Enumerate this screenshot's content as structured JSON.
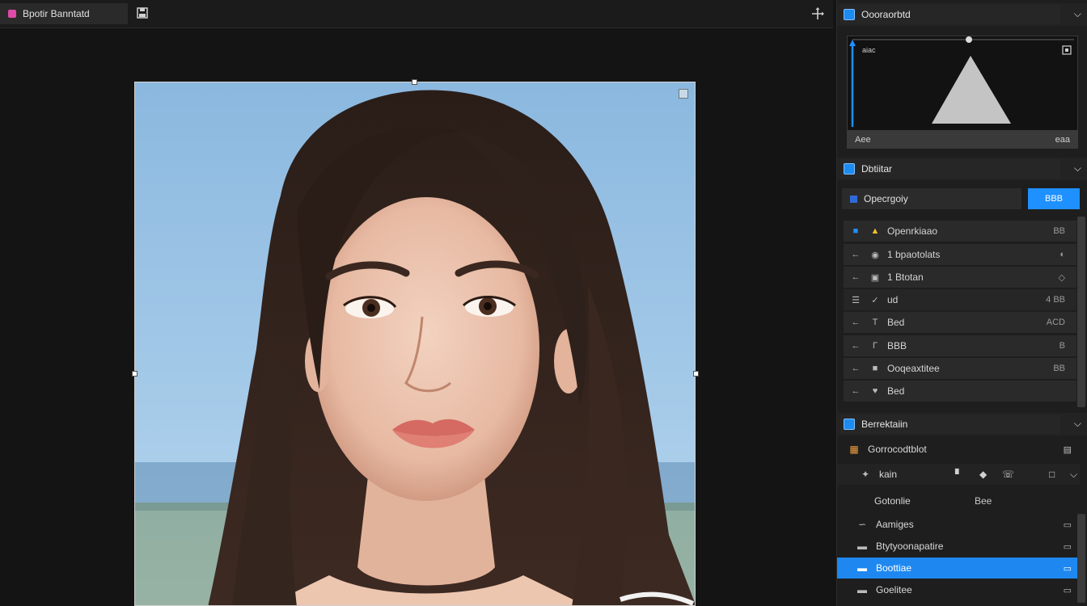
{
  "tab": {
    "title": "Bpotir Banntatd"
  },
  "histogram": {
    "title": "Oooraorbtd",
    "corner_label": "aiac",
    "foot_left": "Aee",
    "foot_right": "eaa"
  },
  "layers_panel": {
    "title": "Dbtiitar",
    "blend_mode": "Opecrgoiy",
    "blend_button": "BBB",
    "rows": [
      {
        "label": "Openrkiaao",
        "right": "BB"
      },
      {
        "label": "1   bpaotolats",
        "right": "◐"
      },
      {
        "label": "1   Btotan",
        "right": "◇"
      },
      {
        "label": "ud",
        "right": "4 BB"
      },
      {
        "label": "Bed",
        "right": "ACD"
      },
      {
        "label": "BBB",
        "right": "B"
      },
      {
        "label": "Ooqeaxtitee",
        "right": "BB"
      },
      {
        "label": "Bed",
        "right": ""
      }
    ]
  },
  "adjust_panel": {
    "title": "Berrektaiin",
    "subtitle": "Gorrocodtblot",
    "tool_label": "kain",
    "subheader_left": "Gotonlie",
    "subheader_right": "Bee",
    "rows": [
      {
        "label": "Aamiges",
        "right": "▭",
        "selected": false
      },
      {
        "label": "Btytyoonapatire",
        "right": "▭",
        "selected": false
      },
      {
        "label": "Boottiae",
        "right": "▭",
        "selected": true
      },
      {
        "label": "Goelitee",
        "right": "▭",
        "selected": false
      }
    ]
  },
  "colors": {
    "accent": "#1e90ff",
    "tab_swatch": "#e04aa8",
    "bg": "#141414",
    "panel": "#1e1e1e"
  }
}
